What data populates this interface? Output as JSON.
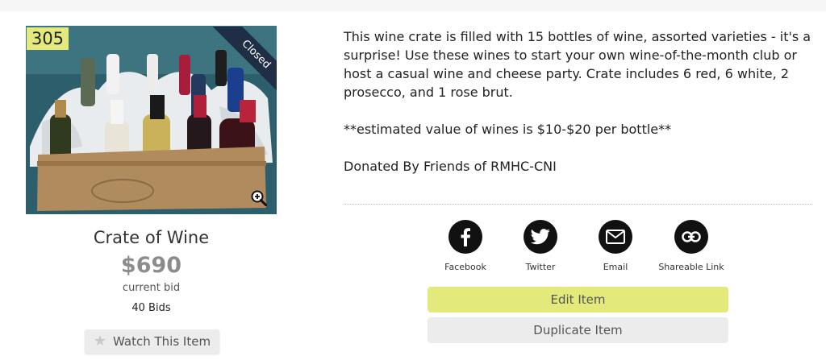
{
  "item": {
    "lot_number": "305",
    "status": "Closed",
    "title": "Crate of Wine",
    "current_bid": "$690",
    "current_bid_caption": "current bid",
    "bid_count": "40 Bids",
    "watch_label": "Watch This Item"
  },
  "description": {
    "paragraphs": [
      "This wine crate is filled with 15 bottles of wine, assorted varieties - it's a surprise! Use these wines to start your own wine-of-the-month club or host a casual wine and cheese party. Crate includes 6 red, 6 white, 2 prosecco, and 1 rose brut.",
      "**estimated value of wines is $10-$20 per bottle**",
      "Donated By Friends of RMHC-CNI"
    ]
  },
  "share": [
    {
      "label": "Facebook",
      "icon": "facebook-icon"
    },
    {
      "label": "Twitter",
      "icon": "twitter-icon"
    },
    {
      "label": "Email",
      "icon": "envelope-icon"
    },
    {
      "label": "Shareable Link",
      "icon": "link-icon"
    }
  ],
  "actions": {
    "edit_label": "Edit Item",
    "duplicate_label": "Duplicate Item"
  },
  "colors": {
    "accent": "#e4e97c",
    "ribbon": "#1f2e45",
    "button_gray": "#ececec",
    "bid_amount": "#8c8c8c"
  }
}
